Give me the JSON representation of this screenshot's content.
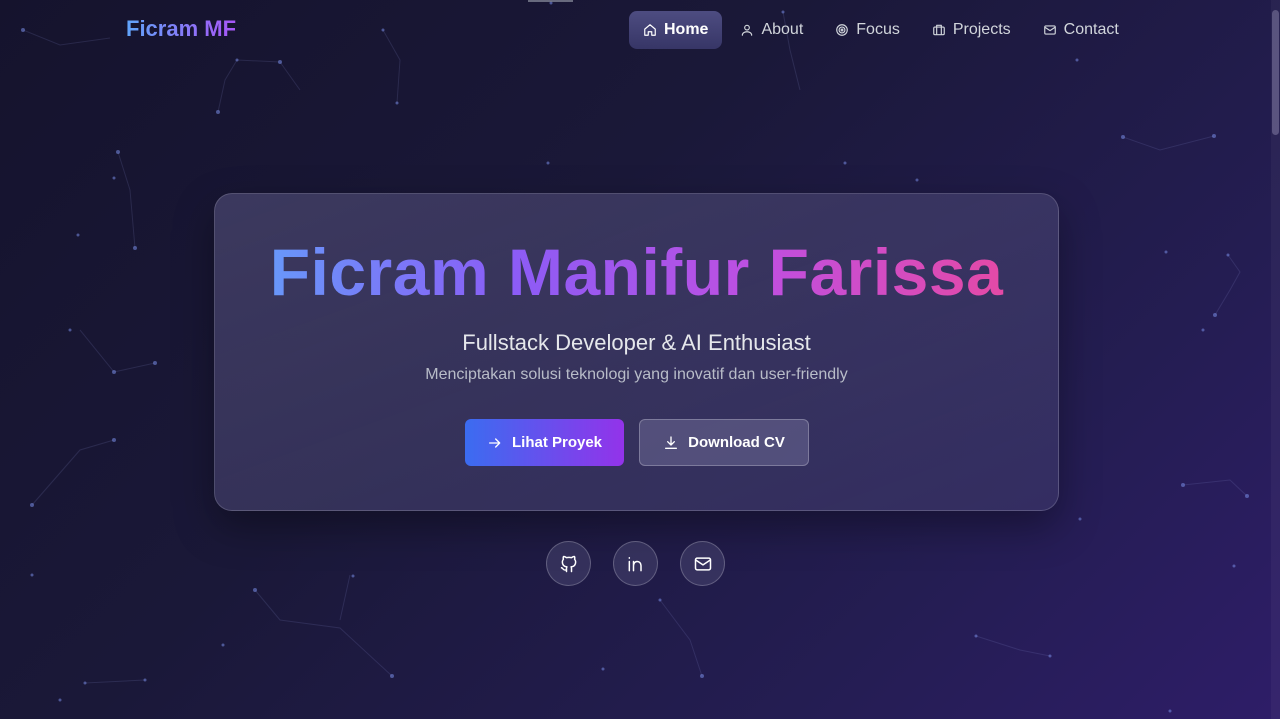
{
  "header": {
    "logo": "Ficram MF"
  },
  "nav": {
    "items": [
      {
        "label": "Home",
        "icon": "home-icon",
        "active": true
      },
      {
        "label": "About",
        "icon": "user-icon",
        "active": false
      },
      {
        "label": "Focus",
        "icon": "target-icon",
        "active": false
      },
      {
        "label": "Projects",
        "icon": "briefcase-icon",
        "active": false
      },
      {
        "label": "Contact",
        "icon": "mail-icon",
        "active": false
      }
    ]
  },
  "hero": {
    "title": "Ficram Manifur Farissa",
    "subtitle": "Fullstack Developer & AI Enthusiast",
    "tagline": "Menciptakan solusi teknologi yang inovatif dan user-friendly",
    "primary_button": "Lihat Proyek",
    "secondary_button": "Download CV"
  },
  "socials": [
    {
      "icon": "github-icon"
    },
    {
      "icon": "linkedin-icon"
    },
    {
      "icon": "mail-icon"
    }
  ],
  "colors": {
    "background": "#1a1838",
    "accent_blue": "#60a5fa",
    "accent_purple": "#8b5cf6",
    "accent_pink": "#ec4899"
  }
}
